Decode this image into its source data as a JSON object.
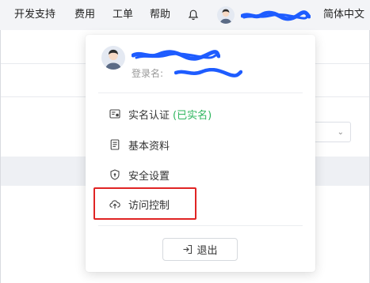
{
  "topbar": {
    "items": [
      "开发支持",
      "费用",
      "工单",
      "帮助"
    ],
    "bell_icon": "bell-icon",
    "avatar_icon": "user-avatar-icon",
    "username_redacted": "",
    "language": "简体中文"
  },
  "page": {
    "select_chevron": "⌄"
  },
  "dropdown": {
    "user": {
      "display_name_redacted": "",
      "login_label": "登录名:",
      "login_value_redacted": ""
    },
    "menu": [
      {
        "label": "实名认证",
        "badge": "(已实名)",
        "icon": "id-card-icon"
      },
      {
        "label": "基本资料",
        "icon": "document-icon"
      },
      {
        "label": "安全设置",
        "icon": "shield-icon"
      },
      {
        "label": "访问控制",
        "icon": "cloud-upload-icon"
      }
    ],
    "logout_label": "退出",
    "colors": {
      "verified": "#2db55d",
      "highlight_border": "#e02424",
      "scribble": "#1e5cff"
    }
  }
}
